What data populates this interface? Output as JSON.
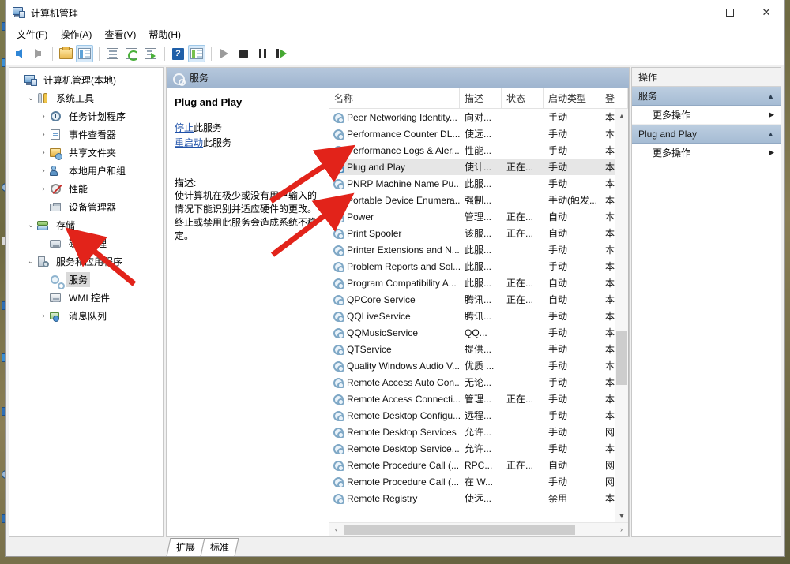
{
  "window": {
    "title": "计算机管理",
    "icon": "computer-management-icon",
    "minimize_label": "最小化",
    "maximize_label": "最大化",
    "close_label": "关闭"
  },
  "menubar": [
    {
      "label": "文件(F)",
      "text": "文件",
      "accel": "F"
    },
    {
      "label": "操作(A)",
      "text": "操作",
      "accel": "A"
    },
    {
      "label": "查看(V)",
      "text": "查看",
      "accel": "V"
    },
    {
      "label": "帮助(H)",
      "text": "帮助",
      "accel": "H"
    }
  ],
  "toolbar": [
    {
      "name": "back-icon",
      "tip": "后退"
    },
    {
      "name": "forward-icon",
      "tip": "前进"
    },
    {
      "name": "up-folder-icon",
      "tip": "向上一级"
    },
    {
      "name": "show-hide-tree-icon",
      "tip": "显示/隐藏控制台树",
      "active": true
    },
    {
      "name": "properties-icon",
      "tip": "属性"
    },
    {
      "name": "refresh-icon",
      "tip": "刷新"
    },
    {
      "name": "export-list-icon",
      "tip": "导出列表"
    },
    {
      "name": "help-icon",
      "tip": "帮助"
    },
    {
      "name": "show-action-pane-icon",
      "tip": "显示/隐藏操作窗格",
      "active": true
    },
    {
      "name": "start-service-icon",
      "tip": "启动服务"
    },
    {
      "name": "stop-service-icon",
      "tip": "停止服务"
    },
    {
      "name": "pause-service-icon",
      "tip": "暂停服务"
    },
    {
      "name": "restart-service-icon",
      "tip": "重新启动服务"
    }
  ],
  "tree": [
    {
      "label": "计算机管理(本地)",
      "icon": "computer-icon",
      "indent": 0,
      "twisty": "",
      "selected": false
    },
    {
      "label": "系统工具",
      "icon": "tools-icon",
      "indent": 1,
      "twisty": "v",
      "selected": false
    },
    {
      "label": "任务计划程序",
      "icon": "clock-icon",
      "indent": 2,
      "twisty": ">",
      "selected": false
    },
    {
      "label": "事件查看器",
      "icon": "event-icon",
      "indent": 2,
      "twisty": ">",
      "selected": false
    },
    {
      "label": "共享文件夹",
      "icon": "shared-folder-icon",
      "indent": 2,
      "twisty": ">",
      "selected": false
    },
    {
      "label": "本地用户和组",
      "icon": "users-icon",
      "indent": 2,
      "twisty": ">",
      "selected": false
    },
    {
      "label": "性能",
      "icon": "performance-icon",
      "indent": 2,
      "twisty": ">",
      "selected": false
    },
    {
      "label": "设备管理器",
      "icon": "device-manager-icon",
      "indent": 2,
      "twisty": "",
      "selected": false
    },
    {
      "label": "存储",
      "icon": "storage-icon",
      "indent": 1,
      "twisty": "v",
      "selected": false
    },
    {
      "label": "磁盘管理",
      "icon": "disk-icon",
      "indent": 2,
      "twisty": "",
      "selected": false
    },
    {
      "label": "服务和应用程序",
      "icon": "services-apps-icon",
      "indent": 1,
      "twisty": "v",
      "selected": false
    },
    {
      "label": "服务",
      "icon": "service-icon",
      "indent": 2,
      "twisty": "",
      "selected": true
    },
    {
      "label": "WMI 控件",
      "icon": "wmi-icon",
      "indent": 2,
      "twisty": "",
      "selected": false
    },
    {
      "label": "消息队列",
      "icon": "message-queue-icon",
      "indent": 2,
      "twisty": ">",
      "selected": false
    }
  ],
  "center": {
    "header_title": "服务",
    "header_icon": "service-icon"
  },
  "detail": {
    "service_name": "Plug and Play",
    "stop_link": "停止",
    "stop_suffix": "此服务",
    "restart_link": "重启动",
    "restart_suffix": "此服务",
    "description_label": "描述:",
    "description_text": "使计算机在极少或没有用户输入的情况下能识别并适应硬件的更改。终止或禁用此服务会造成系统不稳定。"
  },
  "list": {
    "columns": [
      {
        "key": "name",
        "label": "名称",
        "sorted": true
      },
      {
        "key": "desc",
        "label": "描述",
        "sorted": false
      },
      {
        "key": "status",
        "label": "状态",
        "sorted": false
      },
      {
        "key": "start",
        "label": "启动类型",
        "sorted": false
      },
      {
        "key": "logon",
        "label": "登",
        "sorted": false
      }
    ],
    "rows": [
      {
        "name": "Peer Networking Identity...",
        "desc": "向对...",
        "status": "",
        "start": "手动",
        "logon": "本",
        "selected": false
      },
      {
        "name": "Performance Counter DL...",
        "desc": "使远...",
        "status": "",
        "start": "手动",
        "logon": "本",
        "selected": false
      },
      {
        "name": "Performance Logs & Aler...",
        "desc": "性能...",
        "status": "",
        "start": "手动",
        "logon": "本",
        "selected": false
      },
      {
        "name": "Plug and Play",
        "desc": "使计...",
        "status": "正在...",
        "start": "手动",
        "logon": "本",
        "selected": true
      },
      {
        "name": "PNRP Machine Name Pu...",
        "desc": "此服...",
        "status": "",
        "start": "手动",
        "logon": "本",
        "selected": false
      },
      {
        "name": "Portable Device Enumera...",
        "desc": "强制...",
        "status": "",
        "start": "手动(触发...",
        "logon": "本",
        "selected": false
      },
      {
        "name": "Power",
        "desc": "管理...",
        "status": "正在...",
        "start": "自动",
        "logon": "本",
        "selected": false
      },
      {
        "name": "Print Spooler",
        "desc": "该服...",
        "status": "正在...",
        "start": "自动",
        "logon": "本",
        "selected": false
      },
      {
        "name": "Printer Extensions and N...",
        "desc": "此服...",
        "status": "",
        "start": "手动",
        "logon": "本",
        "selected": false
      },
      {
        "name": "Problem Reports and Sol...",
        "desc": "此服...",
        "status": "",
        "start": "手动",
        "logon": "本",
        "selected": false
      },
      {
        "name": "Program Compatibility A...",
        "desc": "此服...",
        "status": "正在...",
        "start": "自动",
        "logon": "本",
        "selected": false
      },
      {
        "name": "QPCore Service",
        "desc": "腾讯...",
        "status": "正在...",
        "start": "自动",
        "logon": "本",
        "selected": false
      },
      {
        "name": "QQLiveService",
        "desc": "腾讯...",
        "status": "",
        "start": "手动",
        "logon": "本",
        "selected": false
      },
      {
        "name": "QQMusicService",
        "desc": "QQ...",
        "status": "",
        "start": "手动",
        "logon": "本",
        "selected": false
      },
      {
        "name": "QTService",
        "desc": "提供...",
        "status": "",
        "start": "手动",
        "logon": "本",
        "selected": false
      },
      {
        "name": "Quality Windows Audio V...",
        "desc": "优质 ...",
        "status": "",
        "start": "手动",
        "logon": "本",
        "selected": false
      },
      {
        "name": "Remote Access Auto Con...",
        "desc": "无论...",
        "status": "",
        "start": "手动",
        "logon": "本",
        "selected": false
      },
      {
        "name": "Remote Access Connecti...",
        "desc": "管理...",
        "status": "正在...",
        "start": "手动",
        "logon": "本",
        "selected": false
      },
      {
        "name": "Remote Desktop Configu...",
        "desc": "远程...",
        "status": "",
        "start": "手动",
        "logon": "本",
        "selected": false
      },
      {
        "name": "Remote Desktop Services",
        "desc": "允许...",
        "status": "",
        "start": "手动",
        "logon": "网",
        "selected": false
      },
      {
        "name": "Remote Desktop Service...",
        "desc": "允许...",
        "status": "",
        "start": "手动",
        "logon": "本",
        "selected": false
      },
      {
        "name": "Remote Procedure Call (...",
        "desc": "RPC...",
        "status": "正在...",
        "start": "自动",
        "logon": "网",
        "selected": false
      },
      {
        "name": "Remote Procedure Call (...",
        "desc": "在 W...",
        "status": "",
        "start": "手动",
        "logon": "网",
        "selected": false
      },
      {
        "name": "Remote Registry",
        "desc": "使远...",
        "status": "",
        "start": "禁用",
        "logon": "本",
        "selected": false
      }
    ]
  },
  "actions": {
    "title": "操作",
    "groups": [
      {
        "header": "服务",
        "items": [
          {
            "label": "更多操作"
          }
        ]
      },
      {
        "header": "Plug and Play",
        "items": [
          {
            "label": "更多操作"
          }
        ]
      }
    ]
  },
  "tabs": [
    {
      "label": "扩展",
      "active": false
    },
    {
      "label": "标准",
      "active": true
    }
  ],
  "colors": {
    "header_blue": "#a6bcd4",
    "selection_gray": "#e6e6e6",
    "link_blue": "#1f51a8",
    "annotation_red": "#e2231a"
  }
}
